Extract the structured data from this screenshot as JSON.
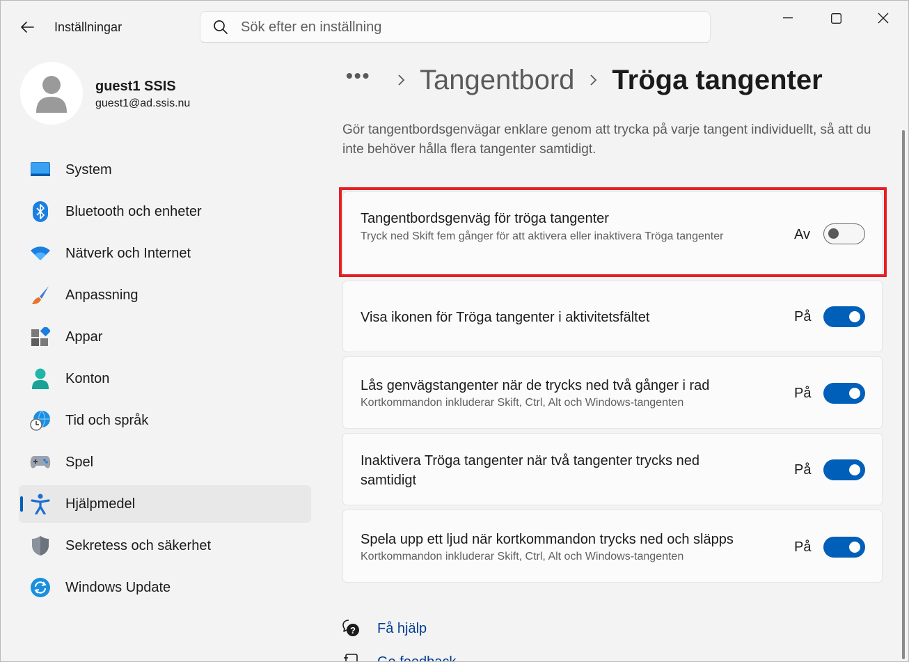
{
  "app": {
    "title": "Inställningar"
  },
  "search": {
    "placeholder": "Sök efter en inställning"
  },
  "user": {
    "name": "guest1 SSIS",
    "email": "guest1@ad.ssis.nu"
  },
  "nav": {
    "items": [
      {
        "label": "System",
        "icon": "monitor-icon"
      },
      {
        "label": "Bluetooth och enheter",
        "icon": "bluetooth-icon"
      },
      {
        "label": "Nätverk och Internet",
        "icon": "wifi-icon"
      },
      {
        "label": "Anpassning",
        "icon": "brush-icon"
      },
      {
        "label": "Appar",
        "icon": "apps-icon"
      },
      {
        "label": "Konton",
        "icon": "person-icon"
      },
      {
        "label": "Tid och språk",
        "icon": "globe-clock-icon"
      },
      {
        "label": "Spel",
        "icon": "gamepad-icon"
      },
      {
        "label": "Hjälpmedel",
        "icon": "accessibility-icon",
        "active": true
      },
      {
        "label": "Sekretess och säkerhet",
        "icon": "shield-icon"
      },
      {
        "label": "Windows Update",
        "icon": "update-icon"
      }
    ]
  },
  "breadcrumb": {
    "more": "•••",
    "parent": "Tangentbord",
    "current": "Tröga tangenter"
  },
  "description": "Gör tangentbordsgenvägar enklare genom att trycka på varje tangent individuellt, så att du inte behöver hålla flera tangenter samtidigt.",
  "settings": [
    {
      "title": "Tangentbordsgenväg för tröga tangenter",
      "subtitle": "Tryck ned Skift fem gånger för att aktivera eller inaktivera Tröga tangenter",
      "state": "Av",
      "on": false
    },
    {
      "title": "Visa ikonen för Tröga tangenter i aktivitetsfältet",
      "subtitle": "",
      "state": "På",
      "on": true
    },
    {
      "title": "Lås genvägstangenter när de trycks ned två gånger i rad",
      "subtitle": "Kortkommandon inkluderar Skift, Ctrl, Alt och Windows-tangenten",
      "state": "På",
      "on": true
    },
    {
      "title": "Inaktivera Tröga tangenter när två tangenter trycks ned samtidigt",
      "subtitle": "",
      "state": "På",
      "on": true
    },
    {
      "title": "Spela upp ett ljud när kortkommandon trycks ned och släpps",
      "subtitle": "Kortkommandon inkluderar Skift, Ctrl, Alt och Windows-tangenten",
      "state": "På",
      "on": true
    }
  ],
  "help": {
    "get_help": "Få hjälp",
    "feedback": "Ge feedback"
  },
  "colors": {
    "accent": "#005fb8",
    "highlight": "#e51f24",
    "link": "#003e92"
  }
}
